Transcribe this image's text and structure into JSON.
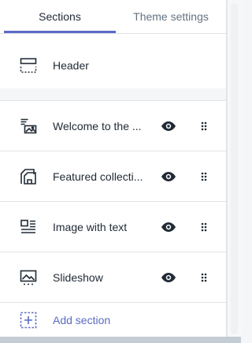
{
  "tabs": {
    "sections_label": "Sections",
    "theme_settings_label": "Theme settings"
  },
  "header_section": {
    "label": "Header",
    "icon": "header-layout-icon"
  },
  "sections": [
    {
      "label": "Welcome to the ...",
      "icon": "image-text-icon",
      "visible": true
    },
    {
      "label": "Featured collecti...",
      "icon": "collection-icon",
      "visible": true
    },
    {
      "label": "Image with text",
      "icon": "image-with-text-icon",
      "visible": true
    },
    {
      "label": "Slideshow",
      "icon": "slideshow-icon",
      "visible": true
    }
  ],
  "add_section": {
    "label": "Add section",
    "icon": "add-section-icon"
  },
  "colors": {
    "accent": "#5c6ac4",
    "text": "#212b36",
    "icon": "#212b36",
    "divider": "#dfe3e8"
  }
}
